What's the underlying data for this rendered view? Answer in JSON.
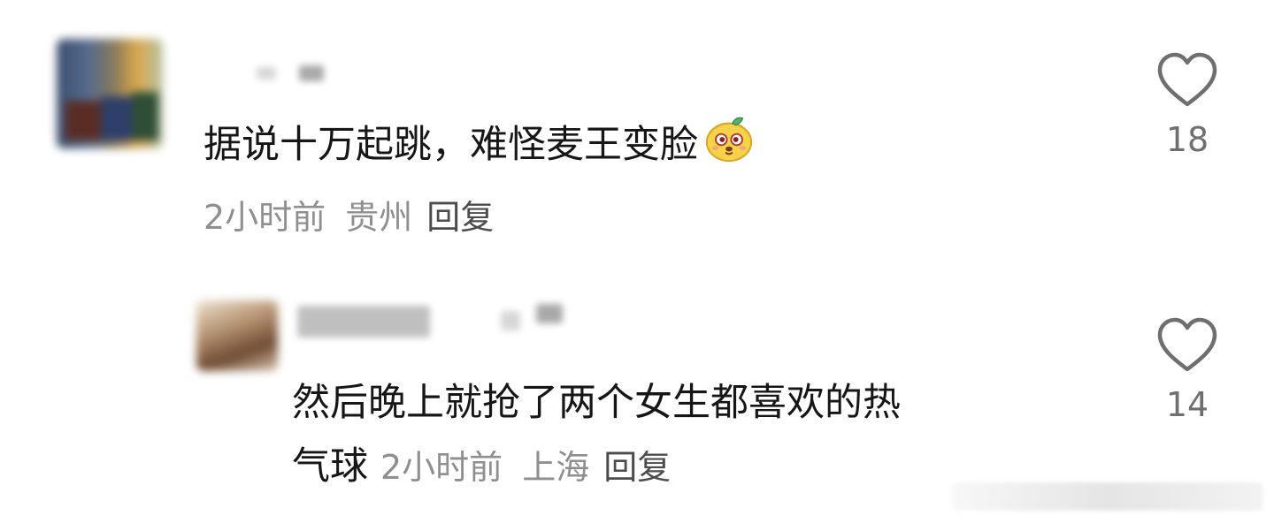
{
  "comments": [
    {
      "text": "据说十万起跳，难怪麦王变脸",
      "emoji": "doge-bean-emoji",
      "time": "2小时前",
      "location": "贵州",
      "reply": "回复",
      "likes": "18"
    },
    {
      "text_line1": "然后晚上就抢了两个女生都喜欢的热",
      "text_line2": "气球",
      "time": "2小时前",
      "location": "上海",
      "reply": "回复",
      "likes": "14"
    }
  ],
  "icons": {
    "like": "heart-outline-icon"
  },
  "colors": {
    "text": "#161616",
    "meta": "#8f8f8f",
    "reply": "#4c4c4c",
    "like_count": "#6f6f6f",
    "background": "#ffffff"
  }
}
